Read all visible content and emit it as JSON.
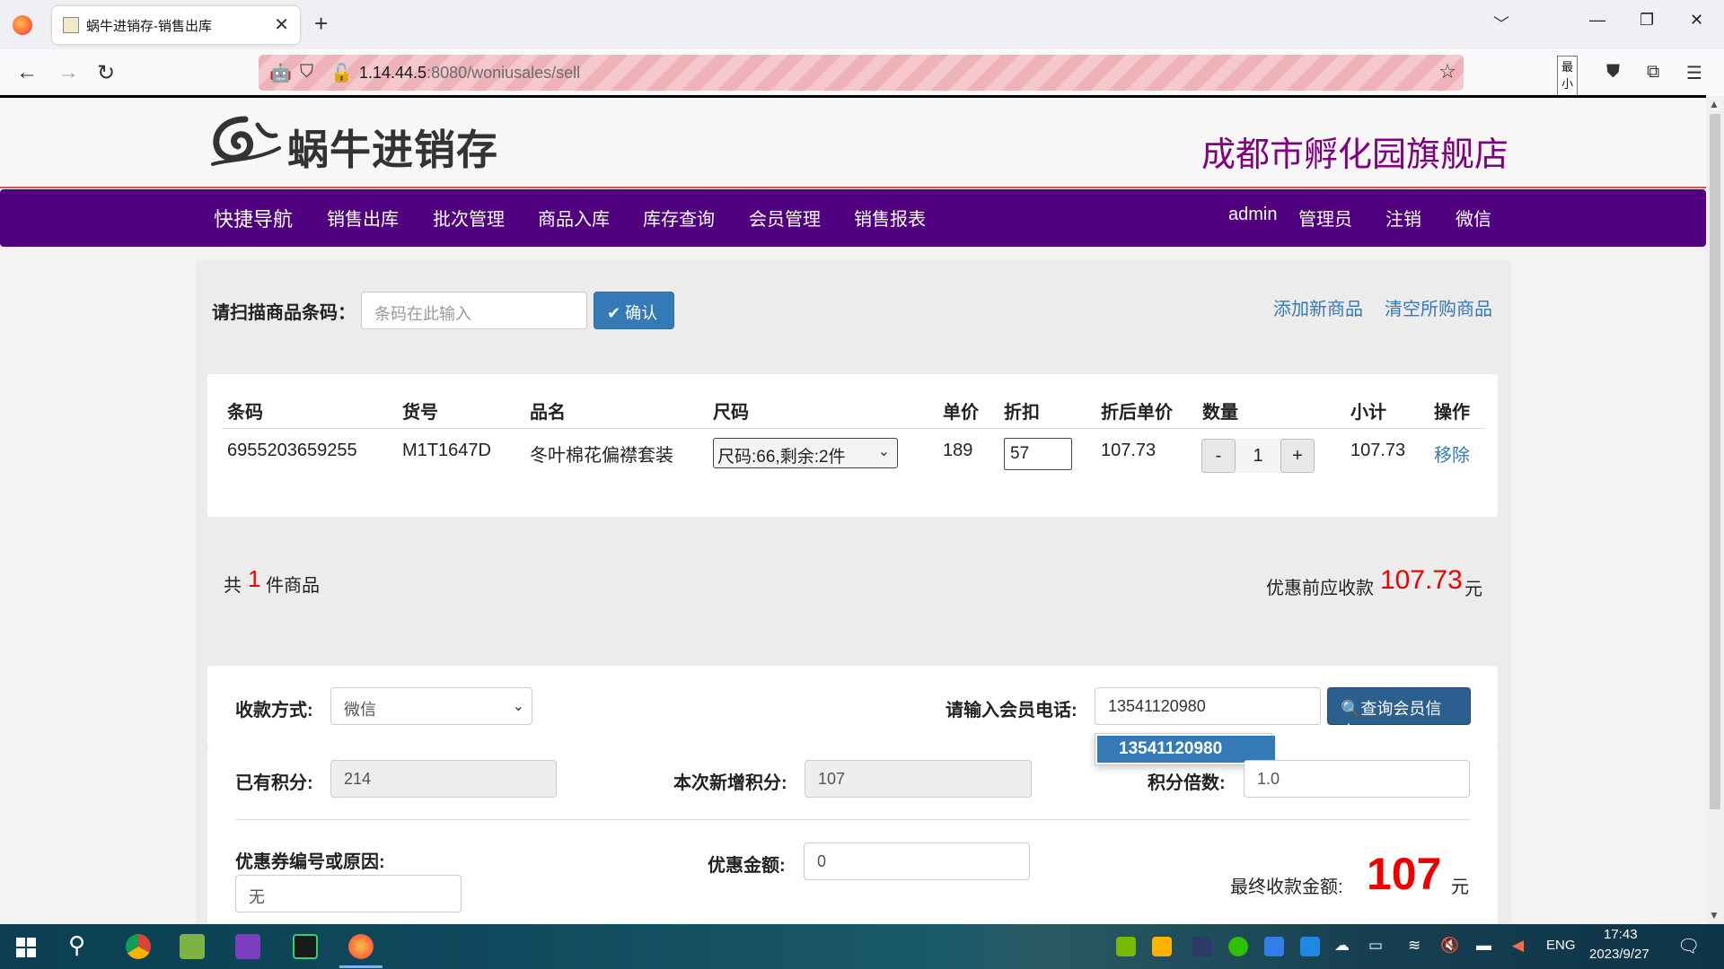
{
  "browser": {
    "tab_title": "蜗牛进销存-销售出库",
    "url_host": "1.14.44.5",
    "url_rest": ":8080/woniusales/sell",
    "tooltip": "最小化"
  },
  "header": {
    "logo_text": "蜗牛进销存",
    "store_name": "成都市孵化园旗舰店"
  },
  "nav": {
    "brand": "快捷导航",
    "items": [
      "销售出库",
      "批次管理",
      "商品入库",
      "库存查询",
      "会员管理",
      "销售报表"
    ],
    "user": "admin",
    "role": "管理员",
    "logout": "注销",
    "wechat": "微信"
  },
  "scan": {
    "label": "请扫描商品条码：",
    "placeholder": "条码在此输入",
    "confirm": "✔ 确认",
    "add_new": "添加新商品",
    "clear_all": "清空所购商品"
  },
  "table": {
    "headers": [
      "条码",
      "货号",
      "品名",
      "尺码",
      "单价",
      "折扣",
      "折后单价",
      "数量",
      "小计",
      "操作"
    ],
    "rows": [
      {
        "barcode": "6955203659255",
        "sku": "M1T1647D",
        "name": "冬叶棉花偏襟套装",
        "size": "尺码:66,剩余:2件",
        "price": "189",
        "discount": "57",
        "discounted_price": "107.73",
        "minus": "-",
        "qty": "1",
        "plus": "+",
        "subtotal": "107.73",
        "action": "移除"
      }
    ]
  },
  "summary": {
    "count_prefix": "共",
    "count": "1",
    "count_suffix": "件商品",
    "pre_label": "优惠前应收款",
    "pre_amount": "107.73",
    "unit": "元"
  },
  "payment": {
    "method_label": "收款方式:",
    "method_value": "微信",
    "phone_label": "请输入会员电话:",
    "phone_value": "13541120980",
    "query_btn": "查询会员信息",
    "suggestion": "13541120980",
    "points_label": "已有积分:",
    "points_value": "214",
    "new_points_label": "本次新增积分:",
    "new_points_value": "107",
    "multiplier_label": "积分倍数:",
    "multiplier_value": "1.0",
    "coupon_label": "优惠券编号或原因:",
    "coupon_value": "无",
    "discount_label": "优惠金额:",
    "discount_value": "0",
    "final_label": "最终收款金额:",
    "final_amount": "107",
    "final_unit": "元"
  },
  "taskbar": {
    "lang": "ENG",
    "time": "17:43",
    "date": "2023/9/27"
  },
  "colors": {
    "nav_bg": "#50007f",
    "store_name": "#800080",
    "primary": "#337ab7",
    "amount_red": "#e00000"
  }
}
